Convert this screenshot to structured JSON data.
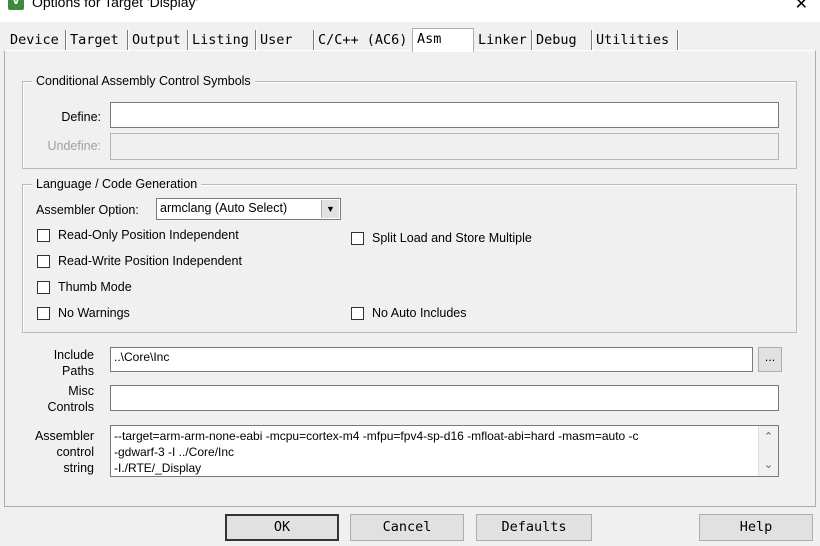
{
  "window": {
    "title": "Options for Target 'Display'",
    "close_glyph": "✕",
    "icon": "keil-uvision-icon"
  },
  "tabs": [
    {
      "label": "Device"
    },
    {
      "label": "Target"
    },
    {
      "label": "Output"
    },
    {
      "label": "Listing"
    },
    {
      "label": "User"
    },
    {
      "label": "C/C++ (AC6)"
    },
    {
      "label": "Asm"
    },
    {
      "label": "Linker"
    },
    {
      "label": "Debug"
    },
    {
      "label": "Utilities"
    }
  ],
  "active_tab": "Asm",
  "conditional": {
    "title": "Conditional Assembly Control Symbols",
    "define_label": "Define:",
    "define_value": "",
    "undefine_label": "Undefine:",
    "undefine_value": ""
  },
  "language": {
    "title": "Language / Code Generation",
    "assembler_option_label": "Assembler Option:",
    "assembler_option_value": "armclang (Auto Select)",
    "options": {
      "ropi": {
        "label": "Read-Only Position Independent",
        "checked": false
      },
      "split_load": {
        "label": "Split Load and Store Multiple",
        "checked": false
      },
      "rwpi": {
        "label": "Read-Write Position Independent",
        "checked": false
      },
      "thumb": {
        "label": "Thumb Mode",
        "checked": false
      },
      "no_warnings": {
        "label": "No Warnings",
        "checked": false
      },
      "no_auto_includes": {
        "label": "No Auto Includes",
        "checked": false
      }
    }
  },
  "include_paths": {
    "label_line1": "Include",
    "label_line2": "Paths",
    "value": "..\\Core\\Inc",
    "browse_label": "..."
  },
  "misc_controls": {
    "label_line1": "Misc",
    "label_line2": "Controls",
    "value": ""
  },
  "control_string": {
    "label_line1": "Assembler",
    "label_line2": "control",
    "label_line3": "string",
    "lines": [
      "--target=arm-arm-none-eabi -mcpu=cortex-m4 -mfpu=fpv4-sp-d16 -mfloat-abi=hard -masm=auto -c",
      "-gdwarf-3 -I ../Core/Inc",
      "-I./RTE/_Display"
    ]
  },
  "buttons": {
    "ok": "OK",
    "cancel": "Cancel",
    "defaults": "Defaults",
    "help": "Help"
  }
}
